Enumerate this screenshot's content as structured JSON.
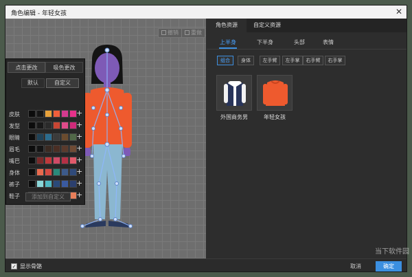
{
  "window": {
    "title": "角色编辑 - 年轻女孩"
  },
  "canvas_toolbar": {
    "undo": "撤销",
    "redo": "重做"
  },
  "color_panel": {
    "tabs": [
      "点击更改",
      "吸色更改"
    ],
    "buttons": [
      "默认",
      "自定义"
    ],
    "rows": [
      {
        "label": "皮肤",
        "swatches": [
          "#0c0c0c",
          "#161616",
          "#e8a23a",
          "#ef5f3b",
          "#d33a8f",
          "#e6318a"
        ]
      },
      {
        "label": "发型",
        "swatches": [
          "#0c0c0c",
          "#181818",
          "#2a2a2a",
          "#c84634",
          "#e04b8a",
          "#d02a7a"
        ]
      },
      {
        "label": "眼睛",
        "swatches": [
          "#0c0c0c",
          "#1f4258",
          "#2b6c8e",
          "#3b3b3b",
          "#6b4b2e",
          "#516848"
        ]
      },
      {
        "label": "眉毛",
        "swatches": [
          "#0c0c0c",
          "#141414",
          "#3a2a22",
          "#4a2e24",
          "#5a3a2c",
          "#6e4a34"
        ]
      },
      {
        "label": "嘴巴",
        "swatches": [
          "#0c0c0c",
          "#7a2a2a",
          "#c0393b",
          "#d04a66",
          "#b53045",
          "#e25a6a"
        ]
      },
      {
        "label": "身体",
        "swatches": [
          "#0c0c0c",
          "#e96a4e",
          "#d64a42",
          "#2a8a7a",
          "#3c5a8a",
          "#2f4a7a"
        ]
      },
      {
        "label": "裤子",
        "swatches": [
          "#0c0c0c",
          "#8ad6d8",
          "#4fb8c2",
          "#2a4a7a",
          "#3a5aa0",
          "#2b3f6e"
        ]
      },
      {
        "label": "鞋子",
        "swatches": [
          "#0c0c0c",
          "#161616",
          "#1e2a3e",
          "#23365a",
          "#3b3b3b",
          "#e87f5a"
        ]
      }
    ],
    "add_button": "添加到自定义"
  },
  "resource_panel": {
    "main_tabs": [
      "角色资源",
      "自定义资源"
    ],
    "sub_tabs": [
      "上半身",
      "下半身",
      "头部",
      "表情"
    ],
    "part_tabs": [
      "组合",
      "身体",
      "左手臂",
      "左手掌",
      "右手臂",
      "右手掌"
    ],
    "items": [
      {
        "label": "外国商务男",
        "color": "#28345a"
      },
      {
        "label": "年轻女孩",
        "color": "#ee5a2e"
      }
    ]
  },
  "bottom": {
    "show_skeleton": "显示骨骼",
    "cancel": "取消",
    "confirm": "确定"
  },
  "watermark": "当下软件园",
  "colors": {
    "accent": "#3d8fe0",
    "confirm_bg": "#3b8fe0",
    "hoodie": "#ee5a2e",
    "pants": "#8bb7d0"
  }
}
